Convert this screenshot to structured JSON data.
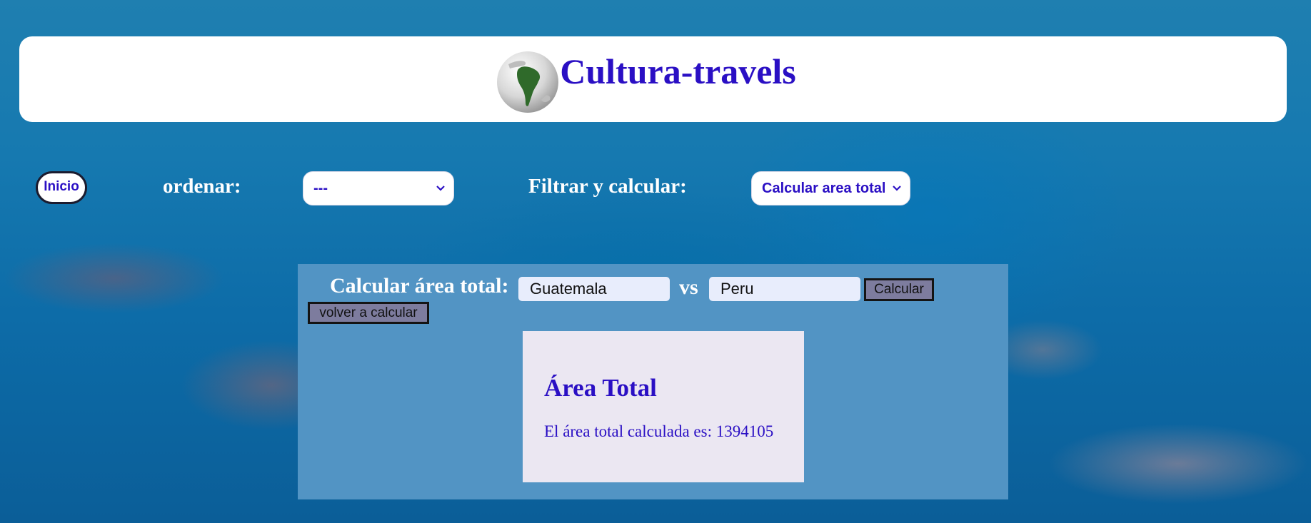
{
  "header": {
    "title": "Cultura-travels",
    "logo_icon": "south-america-globe-icon"
  },
  "toolbar": {
    "home_label": "Inicio",
    "sort_label": "ordenar:",
    "sort_selected": "---",
    "filter_label": "Filtrar y calcular:",
    "filter_selected": "Calcular area total"
  },
  "calculator": {
    "label": "Calcular área total:",
    "country_a": "Guatemala",
    "vs_label": "vs",
    "country_b": "Peru",
    "calculate_label": "Calcular",
    "recalculate_label": "volver a calcular"
  },
  "result": {
    "title": "Área Total",
    "text": "El área total calculada es: 1394105"
  },
  "colors": {
    "accent": "#2a0fc4",
    "panel": "#5294c4",
    "card": "#ebe7f2",
    "button": "#7d7c9e"
  }
}
